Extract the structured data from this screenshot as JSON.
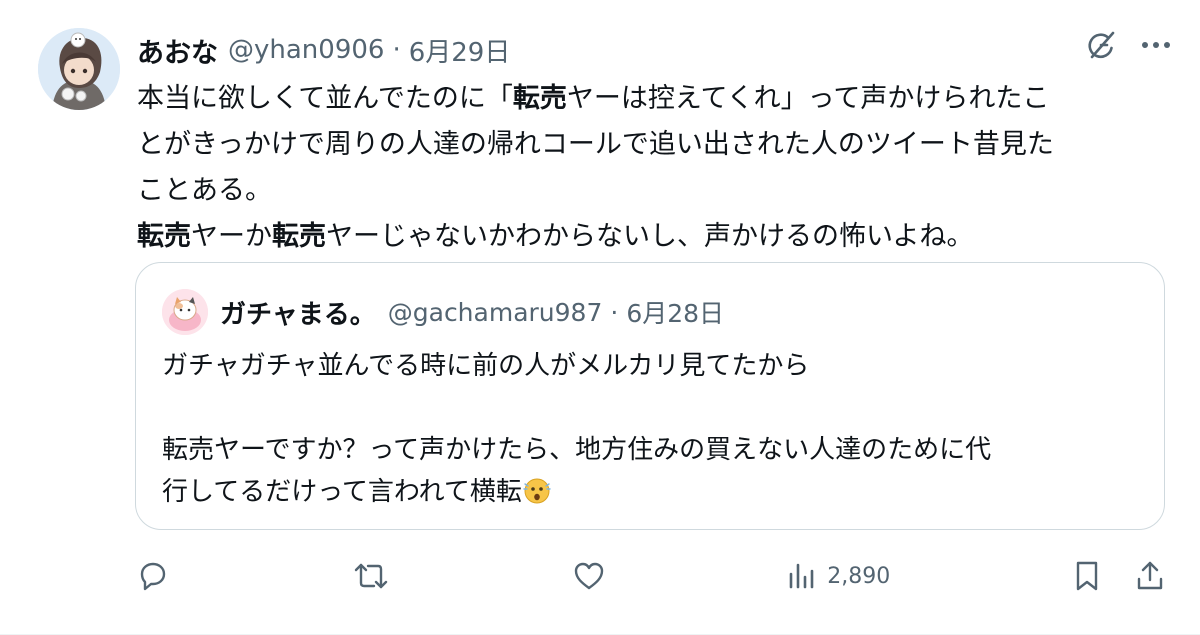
{
  "author": {
    "display_name": "あおな",
    "handle": "@yhan0906",
    "separator": "·",
    "date": "6月29日"
  },
  "tweet_lines": [
    [
      {
        "t": "本当に欲しくて並んでたのに「",
        "b": false
      },
      {
        "t": "転売",
        "b": true
      },
      {
        "t": "ヤーは控えてくれ」って声かけられたこ",
        "b": false
      }
    ],
    [
      {
        "t": "とがきっかけで周りの人達の帰れコールで追い出された人のツイート昔見た",
        "b": false
      }
    ],
    [
      {
        "t": "ことある。",
        "b": false
      }
    ],
    [
      {
        "t": "転売",
        "b": true
      },
      {
        "t": "ヤーか",
        "b": false
      },
      {
        "t": "転売",
        "b": true
      },
      {
        "t": "ヤーじゃないかわからないし、声かけるの怖いよね。",
        "b": false
      }
    ]
  ],
  "quote": {
    "display_name": "ガチャまる。",
    "handle": "@gachamaru987",
    "separator": "·",
    "date": "6月28日",
    "lines": [
      "ガチャガチャ並んでる時に前の人がメルカリ見てたから",
      "",
      "転売ヤーですか？って声かけたら、地方住みの買えない人達のために代",
      "行してるだけって言われて横転"
    ],
    "trailing_emoji": "anxious-sweat-face-emoji"
  },
  "actions": {
    "reply_icon": "reply-icon",
    "retweet_icon": "retweet-icon",
    "like_icon": "like-icon",
    "views_icon": "views-icon",
    "views_count": "2,890",
    "bookmark_icon": "bookmark-icon",
    "share_icon": "share-icon"
  },
  "top_icons": [
    "grok-icon",
    "more-icon"
  ],
  "colors": {
    "text": "#0f1419",
    "secondary": "#536471",
    "border": "#cfd9de"
  }
}
